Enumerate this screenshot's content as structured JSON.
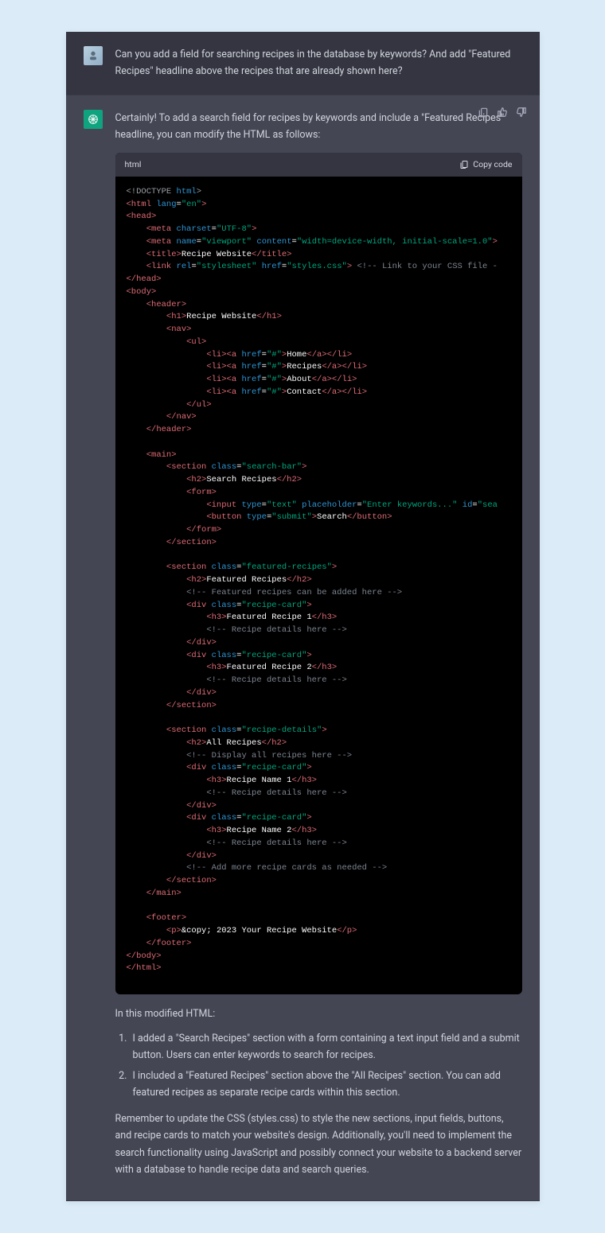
{
  "user_message": "Can you add a field for searching recipes in the database by keywords? And add \"Featured Recipes\" headline above the recipes that are already shown here?",
  "assistant_intro": "Certainly! To add a search field for recipes by keywords and include a \"Featured Recipes\" headline, you can modify the HTML as follows:",
  "code": {
    "lang": "html",
    "copy_label": "Copy code",
    "text": {
      "title": "Recipe Website",
      "h1": "Recipe Website",
      "nav_home": "Home",
      "nav_recipes": "Recipes",
      "nav_about": "About",
      "nav_contact": "Contact",
      "search_h2": "Search Recipes",
      "search_placeholder": "Enter keywords...",
      "search_btn": "Search",
      "featured_h2": "Featured Recipes",
      "featured_cmt": "Featured recipes can be added here",
      "feat1": "Featured Recipe 1",
      "feat2": "Featured Recipe 2",
      "details_cmt": "Recipe details here",
      "all_h2": "All Recipes",
      "all_cmt": "Display all recipes here",
      "rec1": "Recipe Name 1",
      "rec2": "Recipe Name 2",
      "more_cmt": "Add more recipe cards as needed",
      "footer": "2023 Your Recipe Website",
      "link_cmt": "Link to your CSS file -"
    }
  },
  "explain": {
    "heading": "In this modified HTML:",
    "item1": "I added a \"Search Recipes\" section with a form containing a text input field and a submit button. Users can enter keywords to search for recipes.",
    "item2": "I included a \"Featured Recipes\" section above the \"All Recipes\" section. You can add featured recipes as separate recipe cards within this section.",
    "closing": "Remember to update the CSS (styles.css) to style the new sections, input fields, buttons, and recipe cards to match your website's design. Additionally, you'll need to implement the search functionality using JavaScript and possibly connect your website to a backend server with a database to handle recipe data and search queries."
  }
}
